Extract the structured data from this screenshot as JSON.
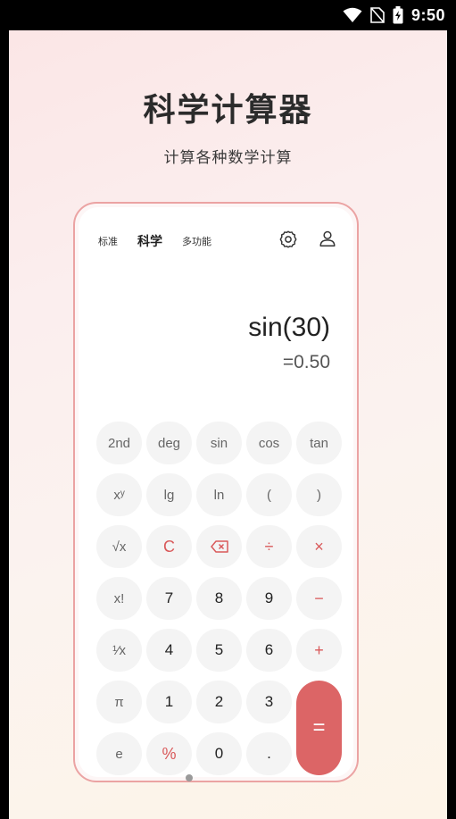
{
  "status_bar": {
    "time": "9:50"
  },
  "headline": "科学计算器",
  "subline": "计算各种数学计算",
  "calculator": {
    "tabs": [
      "标准",
      "科学",
      "多功能"
    ],
    "active_tab": 1,
    "expression": "sin(30)",
    "result": "=0.50",
    "keys": [
      {
        "label": "2nd",
        "name": "key-2nd",
        "style": "fn"
      },
      {
        "label": "deg",
        "name": "key-deg",
        "style": "fn"
      },
      {
        "label": "sin",
        "name": "key-sin",
        "style": "fn"
      },
      {
        "label": "cos",
        "name": "key-cos",
        "style": "fn"
      },
      {
        "label": "tan",
        "name": "key-tan",
        "style": "fn"
      },
      {
        "label": "xʸ",
        "name": "key-power",
        "style": "fn"
      },
      {
        "label": "lg",
        "name": "key-lg",
        "style": "fn"
      },
      {
        "label": "ln",
        "name": "key-ln",
        "style": "fn"
      },
      {
        "label": "(",
        "name": "key-open-paren",
        "style": "fn"
      },
      {
        "label": ")",
        "name": "key-close-paren",
        "style": "fn"
      },
      {
        "label": "√x",
        "name": "key-sqrt",
        "style": "fn"
      },
      {
        "label": "C",
        "name": "key-clear",
        "style": "red"
      },
      {
        "label": "",
        "name": "key-backspace",
        "style": "red",
        "icon": "backspace-icon"
      },
      {
        "label": "÷",
        "name": "key-divide",
        "style": "red"
      },
      {
        "label": "×",
        "name": "key-multiply",
        "style": "red"
      },
      {
        "label": "x!",
        "name": "key-factorial",
        "style": "fn"
      },
      {
        "label": "7",
        "name": "key-7",
        "style": "digit"
      },
      {
        "label": "8",
        "name": "key-8",
        "style": "digit"
      },
      {
        "label": "9",
        "name": "key-9",
        "style": "digit"
      },
      {
        "label": "−",
        "name": "key-minus",
        "style": "red"
      },
      {
        "label": "¹⁄x",
        "name": "key-reciprocal",
        "style": "fn"
      },
      {
        "label": "4",
        "name": "key-4",
        "style": "digit"
      },
      {
        "label": "5",
        "name": "key-5",
        "style": "digit"
      },
      {
        "label": "6",
        "name": "key-6",
        "style": "digit"
      },
      {
        "label": "+",
        "name": "key-plus",
        "style": "red"
      },
      {
        "label": "π",
        "name": "key-pi",
        "style": "fn"
      },
      {
        "label": "1",
        "name": "key-1",
        "style": "digit"
      },
      {
        "label": "2",
        "name": "key-2",
        "style": "digit"
      },
      {
        "label": "3",
        "name": "key-3",
        "style": "digit"
      },
      {
        "label": "e",
        "name": "key-e",
        "style": "fn"
      },
      {
        "label": "%",
        "name": "key-percent",
        "style": "red"
      },
      {
        "label": "0",
        "name": "key-0",
        "style": "digit"
      },
      {
        "label": ".",
        "name": "key-decimal",
        "style": "digit"
      },
      {
        "label": "=",
        "name": "key-equals",
        "style": "equals"
      }
    ],
    "icons": {
      "settings": "gear-icon",
      "account": "user-icon",
      "backspace": "backspace-icon"
    },
    "colors": {
      "accent": "#dc6566",
      "key_bg": "#f4f4f4",
      "frame": "#eba3a3"
    }
  }
}
